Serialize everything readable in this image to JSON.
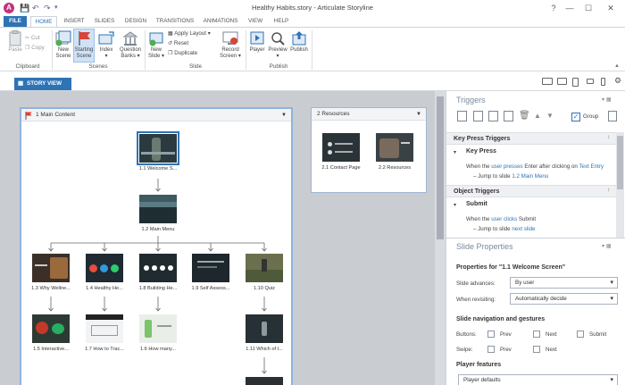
{
  "window": {
    "title": "Healthy Habits.story - Articulate Storyline",
    "app_icon": "A"
  },
  "tabs": [
    "FILE",
    "HOME",
    "INSERT",
    "SLIDES",
    "DESIGN",
    "TRANSITIONS",
    "ANIMATIONS",
    "VIEW",
    "HELP"
  ],
  "ribbon": {
    "paste": "Paste",
    "cut": "Cut",
    "copy": "Copy",
    "clipboard": "Clipboard",
    "new_scene": [
      "New",
      "Scene"
    ],
    "starting_scene": [
      "Starting",
      "Scene"
    ],
    "index": "Index",
    "question_banks": [
      "Question",
      "Banks"
    ],
    "scenes": "Scenes",
    "new_slide": [
      "New",
      "Slide"
    ],
    "apply_layout": "Apply Layout",
    "reset": "Reset",
    "duplicate": "Duplicate",
    "record_screen": [
      "Record",
      "Screen"
    ],
    "slide": "Slide",
    "player": "Player",
    "preview": "Preview",
    "publish": "Publish",
    "publish_group": "Publish"
  },
  "story_view_tab": "STORY VIEW",
  "scenes": {
    "main": {
      "title": "1 Main Content",
      "slides": [
        {
          "label": "1.1 Welcome S...",
          "theme": "welcome"
        },
        {
          "label": "1.2 Main Menu",
          "theme": "lake"
        },
        {
          "label": "1.3 Why Wellne...",
          "theme": "food"
        },
        {
          "label": "1.4 Healthy He...",
          "theme": "circles"
        },
        {
          "label": "1.8 Building He...",
          "theme": "icons"
        },
        {
          "label": "1.9 Self Assess...",
          "theme": "dark"
        },
        {
          "label": "1.10 Quiz",
          "theme": "park"
        },
        {
          "label": "1.5 Interactive...",
          "theme": "fruit"
        },
        {
          "label": "1.7 How to Trac...",
          "theme": "white"
        },
        {
          "label": "1.6 How many...",
          "theme": "bottle"
        },
        {
          "label": "1.11 Which of t...",
          "theme": "runner"
        }
      ]
    },
    "resources": {
      "title": "2 Resources",
      "slides": [
        {
          "label": "2.1 Contact Page",
          "theme": "contact"
        },
        {
          "label": "2.2 Resources",
          "theme": "hands"
        }
      ]
    }
  },
  "triggers": {
    "title": "Triggers",
    "group_label": "Group",
    "group_checked": true,
    "keypress": {
      "header": "Key Press Triggers",
      "name": "Key Press",
      "line1": [
        "When the ",
        "user presses",
        " Enter after clicking on ",
        "Text Entry"
      ],
      "line2": [
        "– Jump to slide ",
        "1.2 Main Menu"
      ]
    },
    "object": {
      "header": "Object Triggers",
      "name": "Submit",
      "line1": [
        "When the ",
        "user clicks",
        " Submit"
      ],
      "line2": [
        "– Jump to slide ",
        "next slide"
      ]
    }
  },
  "slide_properties": {
    "title": "Slide Properties",
    "properties_for": "Properties for \"1.1 Welcome Screen\"",
    "slide_advances_label": "Slide advances:",
    "slide_advances_value": "By user",
    "revisiting_label": "When revisiting:",
    "revisiting_value": "Automatically decide",
    "nav_heading": "Slide navigation and gestures",
    "buttons_label": "Buttons:",
    "swipe_label": "Swipe:",
    "prev": "Prev",
    "next": "Next",
    "submit": "Submit",
    "player_features_heading": "Player features",
    "player_defaults": "Player defaults"
  },
  "colors": {
    "accent": "#2e74b5",
    "app_icon": "#c4317a",
    "starting_flag": "#d9433a"
  }
}
